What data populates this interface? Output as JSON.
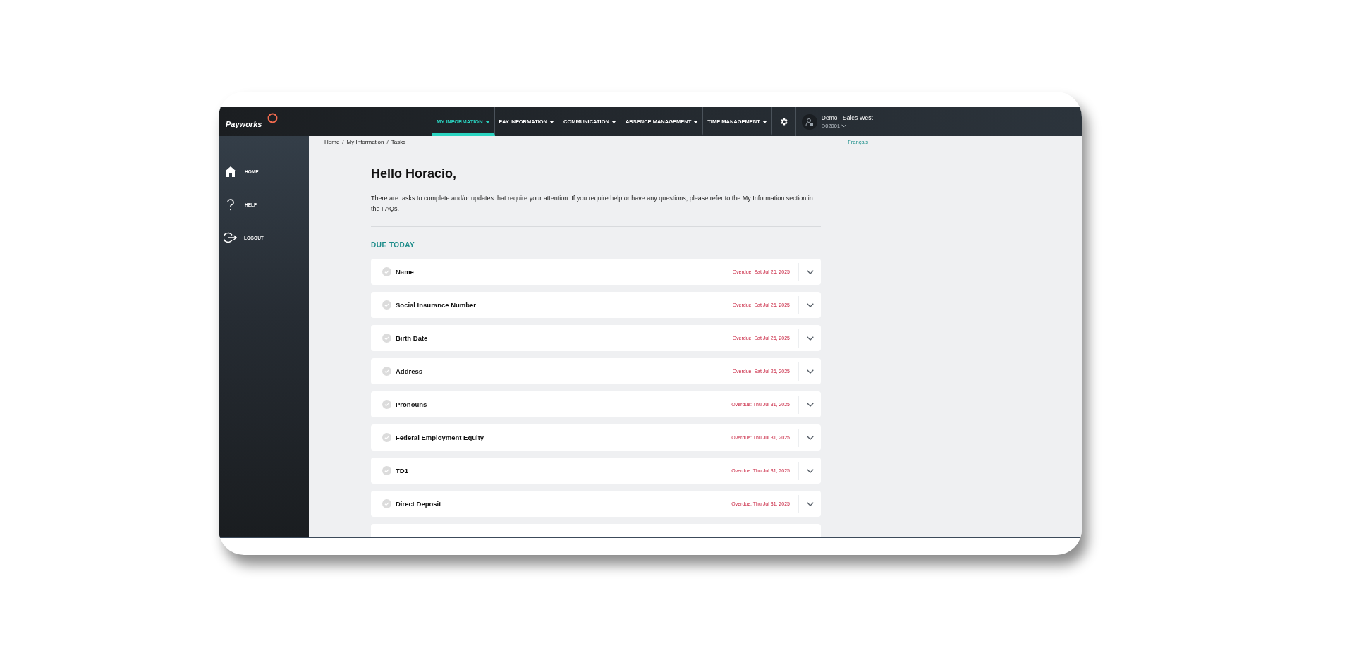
{
  "brand": "Payworks",
  "nav": [
    {
      "label": "MY INFORMATION",
      "selected": true
    },
    {
      "label": "PAY INFORMATION",
      "selected": false
    },
    {
      "label": "COMMUNICATION",
      "selected": false
    },
    {
      "label": "ABSENCE MANAGEMENT",
      "selected": false
    },
    {
      "label": "TIME MANAGEMENT",
      "selected": false
    }
  ],
  "user": {
    "name": "Demo - Sales West",
    "code": "D02001"
  },
  "sidebar": [
    {
      "label": "HOME",
      "kind": "home"
    },
    {
      "label": "HELP",
      "kind": "help"
    },
    {
      "label": "LOGOUT",
      "kind": "logout"
    }
  ],
  "breadcrumb": [
    "Home",
    "My Information",
    "Tasks"
  ],
  "breadcrumb_separator": "/",
  "language_link": "Français",
  "greeting": "Hello Horacio,",
  "intro": "There are tasks to complete and/or updates that require your attention. If you require help or have any questions, please refer to the My Information section in the FAQs.",
  "section_title": "DUE TODAY",
  "tasks": [
    {
      "title": "Name",
      "due": "Overdue: Sat Jul 26, 2025"
    },
    {
      "title": "Social Insurance Number",
      "due": "Overdue: Sat Jul 26, 2025"
    },
    {
      "title": "Birth Date",
      "due": "Overdue: Sat Jul 26, 2025"
    },
    {
      "title": "Address",
      "due": "Overdue: Sat Jul 26, 2025"
    },
    {
      "title": "Pronouns",
      "due": "Overdue: Thu Jul 31, 2025"
    },
    {
      "title": "Federal Employment Equity",
      "due": "Overdue: Thu Jul 31, 2025"
    },
    {
      "title": "TD1",
      "due": "Overdue: Thu Jul 31, 2025"
    },
    {
      "title": "Direct Deposit",
      "due": "Overdue: Thu Jul 31, 2025"
    }
  ]
}
